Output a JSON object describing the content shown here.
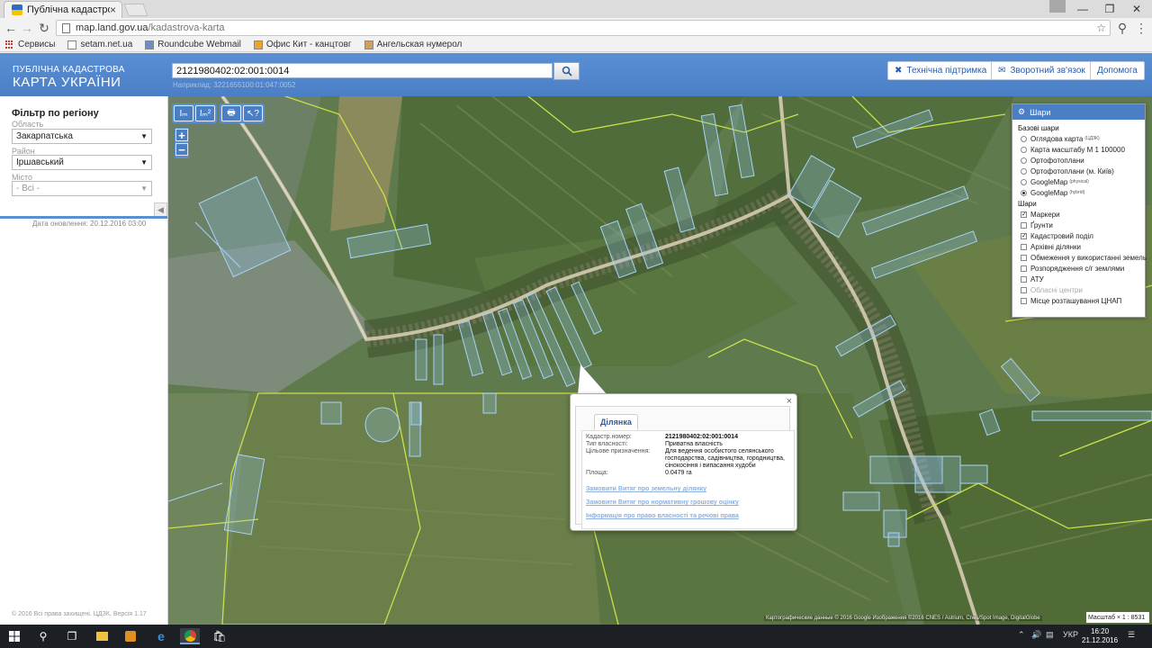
{
  "browser": {
    "tab_title": "Публічна кадастрова ка",
    "tab_close": "×",
    "url_host": "map.land.gov.ua",
    "url_path": "/kadastrova-karta",
    "bookmarks": [
      {
        "label": "Сервисы"
      },
      {
        "label": "setam.net.ua"
      },
      {
        "label": "Roundcube Webmail"
      },
      {
        "label": "Офис Кит - канцтовг"
      },
      {
        "label": "Ангельская нумерол"
      }
    ]
  },
  "header": {
    "logo_small": "ПУБЛІЧНА КАДАСТРОВА",
    "logo_big": "КАРТА УКРАЇНИ",
    "search_value": "2121980402:02:001:0014",
    "search_hint": "Наприклад: 3221655100:01:047:0052",
    "buttons": {
      "support": "Технічна підтримка",
      "feedback": "Зворотний зв'язок",
      "help": "Допомога"
    }
  },
  "sidebar": {
    "title": "Фільтр по регіону",
    "oblast_label": "Область",
    "oblast_value": "Закарпатська",
    "rayon_label": "Район",
    "rayon_value": "Іршавський",
    "misto_label": "Місто",
    "misto_value": "- Всі -",
    "update_date": "Дата оновлення: 20.12.2016 03:00",
    "copyright": "© 2016 Всі права захищені. ЦДЗК. Версія 1.17"
  },
  "map": {
    "tools": [
      "Iₘ",
      "Iₘ²",
      "🖶",
      "↖?"
    ],
    "zoom_in": "+",
    "zoom_out": "−",
    "attribution": "Картографические данные © 2016 Google Изображения ©2016 CNES / Astrium, Cnes/Spot Image, DigitalGlobe",
    "scale": "Масштаб × 1 : 8531"
  },
  "layers": {
    "title": "Шари",
    "base_title": "Базові шари",
    "base": [
      {
        "label": "Оглядова карта",
        "sup": "(ЦДЗК)",
        "selected": false
      },
      {
        "label": "Карта масштабу М 1 100000",
        "sup": "",
        "selected": false
      },
      {
        "label": "Ортофотоплани",
        "sup": "",
        "selected": false
      },
      {
        "label": "Ортофотоплани (м. Київ)",
        "sup": "",
        "selected": false
      },
      {
        "label": "GoogleMap",
        "sup": "(physical)",
        "selected": false
      },
      {
        "label": "GoogleMap",
        "sup": "(hybrid)",
        "selected": true
      }
    ],
    "layers_title": "Шари",
    "layers": [
      {
        "label": "Маркери",
        "checked": true,
        "disabled": false
      },
      {
        "label": "Ґрунти",
        "checked": false,
        "disabled": false
      },
      {
        "label": "Кадастровий поділ",
        "checked": true,
        "disabled": false
      },
      {
        "label": "Архівні ділянки",
        "checked": false,
        "disabled": false
      },
      {
        "label": "Обмеження у використанні земель",
        "checked": false,
        "disabled": false
      },
      {
        "label": "Розпорядження с/г землями",
        "checked": false,
        "disabled": false
      },
      {
        "label": "АТУ",
        "checked": false,
        "disabled": false
      },
      {
        "label": "Обласні центри",
        "checked": false,
        "disabled": true
      },
      {
        "label": "Місце розташування ЦНАП",
        "checked": false,
        "disabled": false
      }
    ]
  },
  "popup": {
    "tab": "Ділянка",
    "close": "×",
    "rows": [
      {
        "k": "Кадастр.номер:",
        "v": "2121980402:02:001:0014"
      },
      {
        "k": "Тип власності:",
        "v": "Приватна власність"
      },
      {
        "k": "Цільове призначення:",
        "v": "Для ведення особистого селянського господарства, садівництва, городництва, сінокосіння і випасання худоби"
      },
      {
        "k": "Площа:",
        "v": "0.0479 га"
      }
    ],
    "links": [
      "Замовити Витяг про земельну ділянку",
      "Замовити Витяг про нормативну грошову оцінку",
      "Інформація про право власності та речові права"
    ]
  },
  "taskbar": {
    "lang": "УКР",
    "time": "16:20",
    "date": "21.12.2016"
  }
}
